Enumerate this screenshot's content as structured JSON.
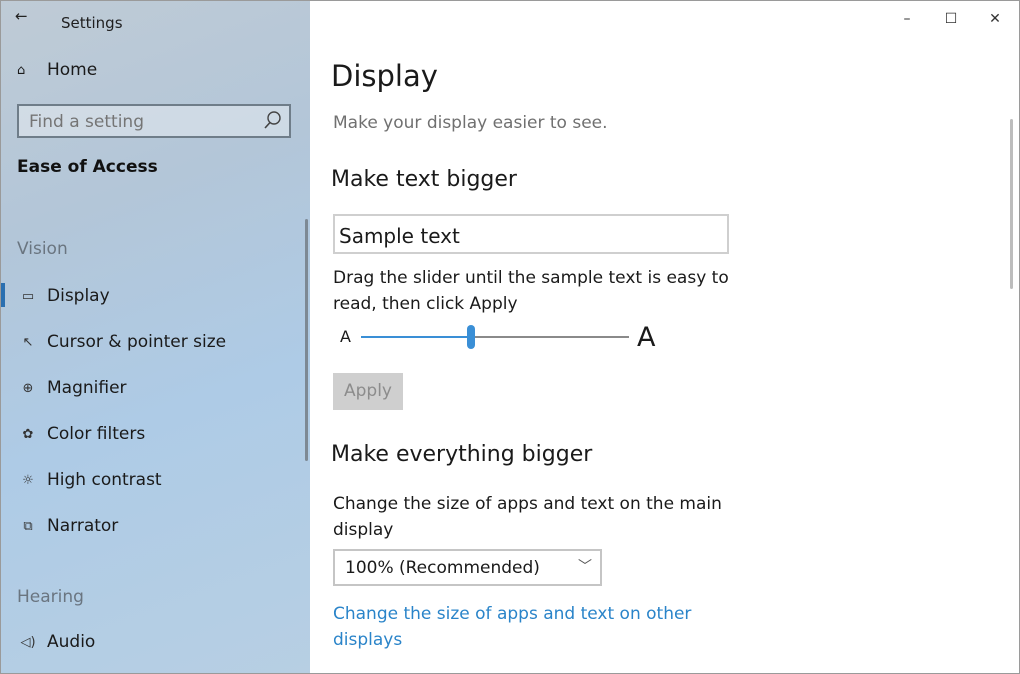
{
  "window": {
    "title": "Settings",
    "controls": {
      "minimize": "–",
      "maximize": "☐",
      "close": "✕"
    }
  },
  "sidebar": {
    "home_label": "Home",
    "search_placeholder": "Find a setting",
    "section_title": "Ease of Access",
    "groups": [
      {
        "label": "Vision"
      },
      {
        "label": "Hearing"
      }
    ],
    "items": [
      {
        "label": "Display",
        "icon": "monitor-icon"
      },
      {
        "label": "Cursor & pointer size",
        "icon": "cursor-icon"
      },
      {
        "label": "Magnifier",
        "icon": "magnifier-icon"
      },
      {
        "label": "Color filters",
        "icon": "palette-icon"
      },
      {
        "label": "High contrast",
        "icon": "sun-icon"
      },
      {
        "label": "Narrator",
        "icon": "narrator-icon"
      },
      {
        "label": "Audio",
        "icon": "speaker-icon"
      }
    ],
    "active_item": "Display"
  },
  "main": {
    "title": "Display",
    "subtitle": "Make your display easier to see.",
    "text_section": {
      "heading": "Make text bigger",
      "sample_text": "Sample text",
      "instructions": "Drag the slider until the sample text is easy to read, then click Apply",
      "slider_small_label": "A",
      "slider_large_label": "A",
      "slider_value": 0.41,
      "apply_label": "Apply"
    },
    "everything_section": {
      "heading": "Make everything bigger",
      "description": "Change the size of apps and text on the main display",
      "scale_value": "100% (Recommended)",
      "link_text": "Change the size of apps and text on other displays"
    }
  },
  "colors": {
    "accent": "#3a8fd6",
    "link": "#2a84c9",
    "active_indicator": "#2a6fb0"
  }
}
